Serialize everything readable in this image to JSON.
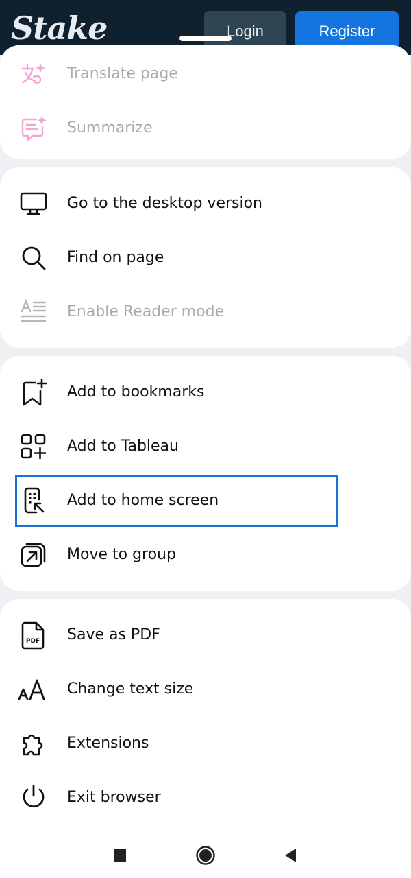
{
  "background_page": {
    "logo_text": "Stake",
    "login_label": "Login",
    "register_label": "Register"
  },
  "menu": {
    "section1": [
      {
        "label": "Translate page",
        "icon": "translate-sparkle-icon",
        "enabled": false
      },
      {
        "label": "Summarize",
        "icon": "summarize-sparkle-icon",
        "enabled": false
      }
    ],
    "section2": [
      {
        "label": "Go to the desktop version",
        "icon": "desktop-monitor-icon",
        "enabled": true
      },
      {
        "label": "Find on page",
        "icon": "search-icon",
        "enabled": true
      },
      {
        "label": "Enable Reader mode",
        "icon": "reader-mode-icon",
        "enabled": false
      }
    ],
    "section3": [
      {
        "label": "Add to bookmarks",
        "icon": "bookmark-add-icon",
        "enabled": true
      },
      {
        "label": "Add to Tableau",
        "icon": "tableau-grid-add-icon",
        "enabled": true
      },
      {
        "label": "Add to home screen",
        "icon": "home-screen-add-icon",
        "enabled": true,
        "highlighted": true
      },
      {
        "label": "Move to group",
        "icon": "move-to-group-icon",
        "enabled": true
      }
    ],
    "section4": [
      {
        "label": "Save as PDF",
        "icon": "pdf-file-icon",
        "enabled": true
      },
      {
        "label": "Change text size",
        "icon": "text-size-icon",
        "enabled": true
      },
      {
        "label": "Extensions",
        "icon": "puzzle-extension-icon",
        "enabled": true
      },
      {
        "label": "Exit browser",
        "icon": "power-icon",
        "enabled": true
      }
    ]
  },
  "system_nav": {
    "recents": "recents-square-icon",
    "home": "home-circle-icon",
    "back": "back-triangle-icon"
  },
  "colors": {
    "accent_highlight": "#1a73d6",
    "disabled_text": "#a9abb0",
    "ai_icon_pink": "#f3a6cf",
    "register_blue": "#1475e1"
  }
}
